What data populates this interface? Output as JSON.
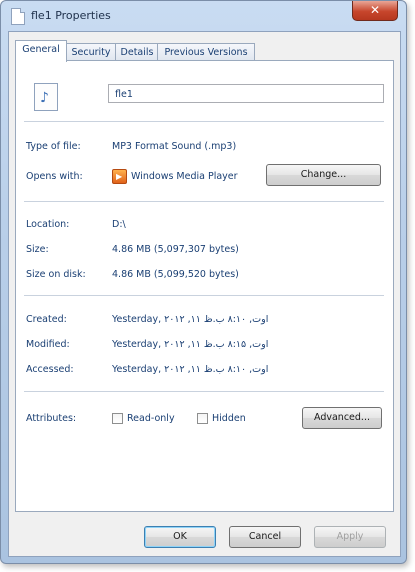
{
  "window": {
    "title": "fle1 Properties",
    "close_glyph": "✕"
  },
  "tabs": [
    {
      "label": "General",
      "active": true
    },
    {
      "label": "Security",
      "active": false
    },
    {
      "label": "Details",
      "active": false
    },
    {
      "label": "Previous Versions",
      "active": false
    }
  ],
  "general": {
    "file_name": "fle1",
    "file_icon": "audio-file-icon",
    "type_label": "Type of file:",
    "type_value": "MP3 Format Sound (.mp3)",
    "opens_label": "Opens with:",
    "opens_value": "Windows Media Player",
    "opens_icon": "windows-media-player-icon",
    "change_button": "Change...",
    "location_label": "Location:",
    "location_value": "D:\\",
    "size_label": "Size:",
    "size_value": "4.86 MB (5,097,307 bytes)",
    "size_on_disk_label": "Size on disk:",
    "size_on_disk_value": "4.86 MB (5,099,520 bytes)",
    "created_label": "Created:",
    "created_value": "Yesterday, ۲۰۱۲ ,۱۱ اوت, ۸:۱۰ ب.ظ",
    "modified_label": "Modified:",
    "modified_value": "Yesterday, ۲۰۱۲ ,۱۱ اوت, ۸:۱۵ ب.ظ",
    "accessed_label": "Accessed:",
    "accessed_value": "Yesterday, ۲۰۱۲ ,۱۱ اوت, ۸:۱۰ ب.ظ",
    "attributes_label": "Attributes:",
    "readonly_label": "Read-only",
    "readonly_checked": false,
    "hidden_label": "Hidden",
    "hidden_checked": false,
    "advanced_button": "Advanced..."
  },
  "footer": {
    "ok": "OK",
    "cancel": "Cancel",
    "apply": "Apply"
  },
  "colors": {
    "label_text": "#1a3f73",
    "close_button": "#c7462c",
    "frame": "#b9cfe9"
  }
}
